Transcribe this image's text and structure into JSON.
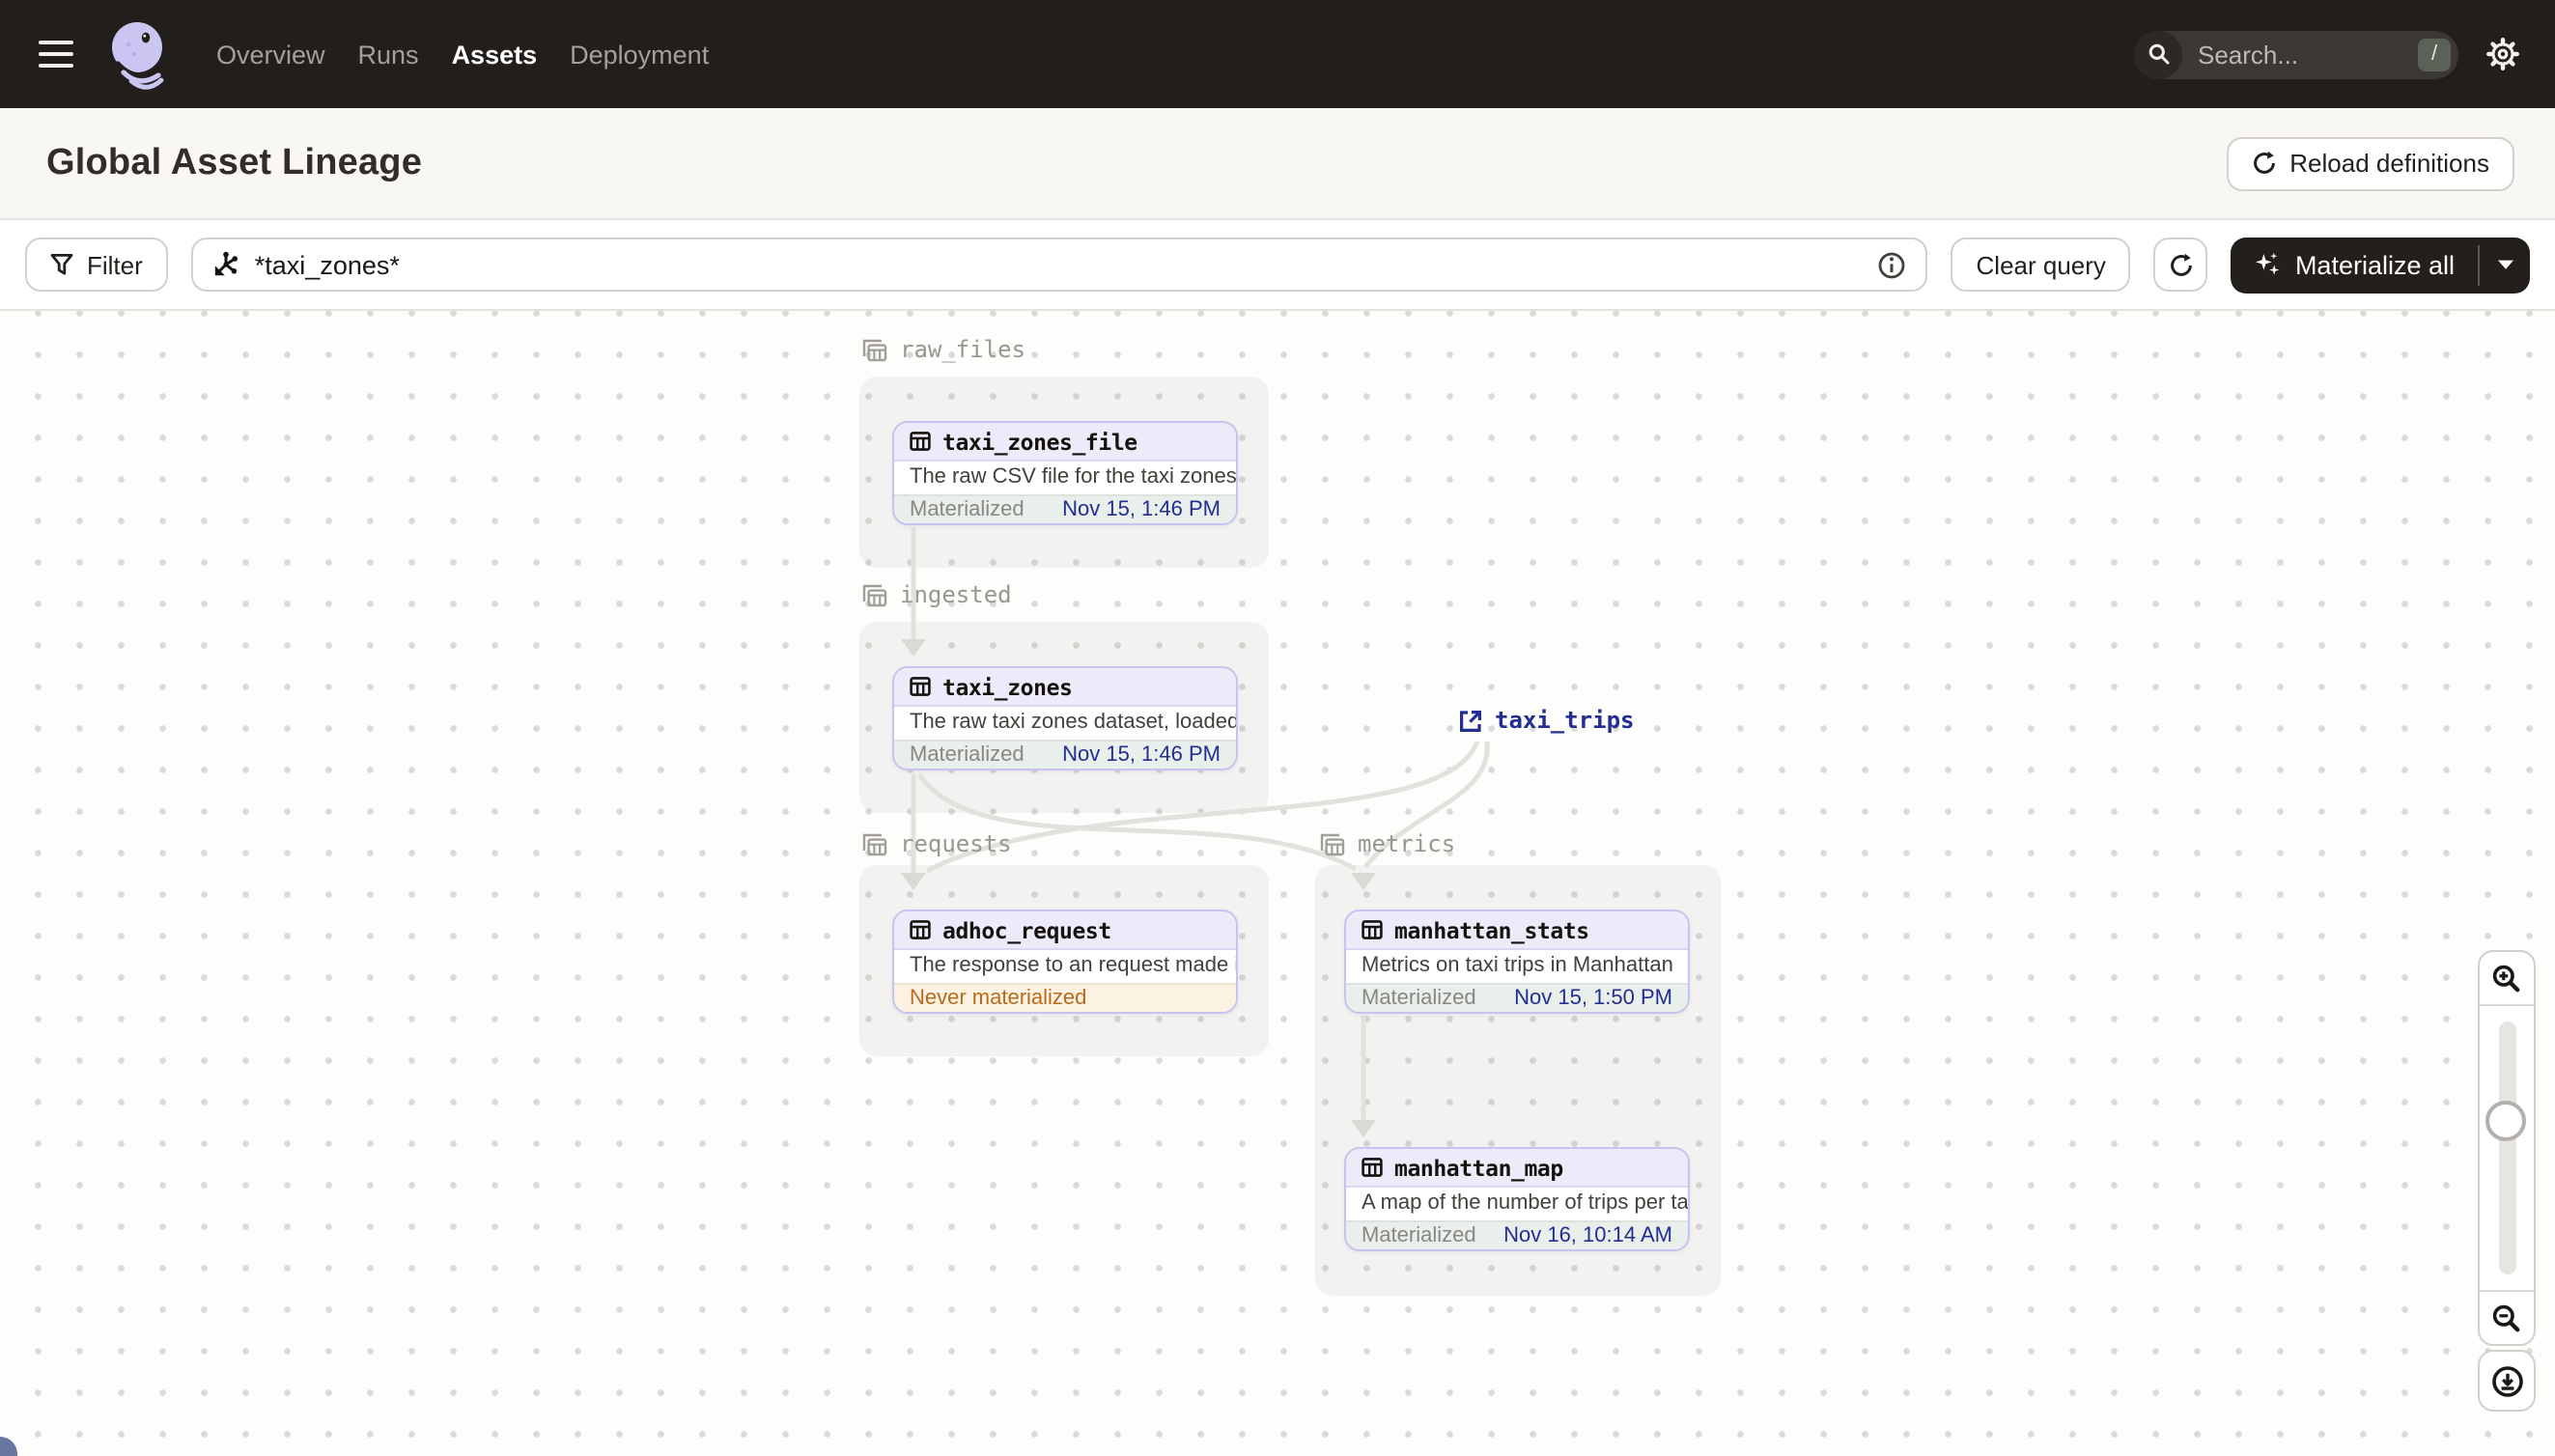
{
  "nav": {
    "items": [
      {
        "label": "Overview",
        "active": false
      },
      {
        "label": "Runs",
        "active": false
      },
      {
        "label": "Assets",
        "active": true
      },
      {
        "label": "Deployment",
        "active": false
      }
    ],
    "search": {
      "placeholder": "Search...",
      "shortcut": "/"
    }
  },
  "header": {
    "title": "Global Asset Lineage",
    "reload_label": "Reload definitions"
  },
  "toolbar": {
    "filter_label": "Filter",
    "query_value": "*taxi_zones*",
    "clear_label": "Clear query",
    "materialize_label": "Materialize all"
  },
  "graph": {
    "groups": [
      {
        "name": "raw_files"
      },
      {
        "name": "ingested"
      },
      {
        "name": "requests"
      },
      {
        "name": "metrics"
      }
    ],
    "nodes": [
      {
        "name": "taxi_zones_file",
        "description": "The raw CSV file for the taxi zones dat...",
        "status_label": "Materialized",
        "status_time": "Nov 15, 1:46 PM",
        "status": "materialized"
      },
      {
        "name": "taxi_zones",
        "description": "The raw taxi zones dataset, loaded int...",
        "status_label": "Materialized",
        "status_time": "Nov 15, 1:46 PM",
        "status": "materialized"
      },
      {
        "name": "adhoc_request",
        "description": "The response to an request made in th...",
        "status_label": "Never materialized",
        "status_time": "",
        "status": "never"
      },
      {
        "name": "manhattan_stats",
        "description": "Metrics on taxi trips in Manhattan",
        "status_label": "Materialized",
        "status_time": "Nov 15, 1:50 PM",
        "status": "materialized"
      },
      {
        "name": "manhattan_map",
        "description": "A map of the number of trips per taxi z...",
        "status_label": "Materialized",
        "status_time": "Nov 16, 10:14 AM",
        "status": "materialized"
      }
    ],
    "external_nodes": [
      {
        "name": "taxi_trips"
      }
    ],
    "edges": [
      {
        "from": "taxi_zones_file",
        "to": "taxi_zones"
      },
      {
        "from": "taxi_zones",
        "to": "adhoc_request"
      },
      {
        "from": "taxi_zones",
        "to": "manhattan_stats"
      },
      {
        "from": "taxi_trips",
        "to": "adhoc_request"
      },
      {
        "from": "taxi_trips",
        "to": "manhattan_stats"
      },
      {
        "from": "manhattan_stats",
        "to": "manhattan_map"
      }
    ]
  },
  "colors": {
    "topbar": "#221e1b",
    "accent_purple_border": "#c8c3ee",
    "node_header_bg": "#edeaf9",
    "status_ok_bg": "#e9efeb",
    "status_time_text": "#232e92",
    "status_never_bg": "#fbf2e2",
    "status_never_text": "#b96a1c",
    "logo_lavender": "#cbc6f1"
  },
  "icons": {
    "query_icon": "op-selector-icon",
    "controls": [
      "zoom-in",
      "zoom-out",
      "download-view"
    ]
  }
}
